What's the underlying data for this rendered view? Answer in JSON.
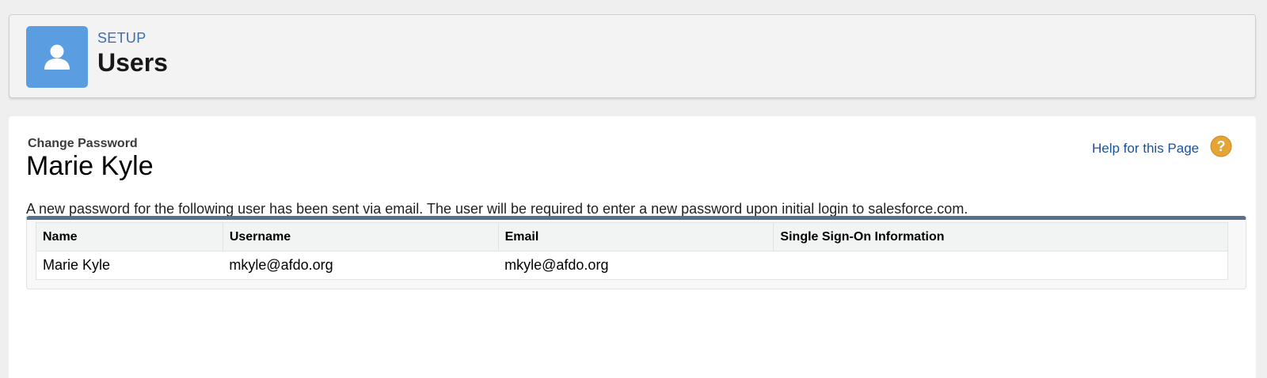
{
  "header": {
    "eyebrow": "SETUP",
    "title": "Users",
    "icon": "user-icon",
    "icon_color": "#5b9de1"
  },
  "main": {
    "subtitle": "Change Password",
    "name": "Marie Kyle",
    "help_label": "Help for this Page",
    "help_icon": "help-icon",
    "help_icon_color": "#e5a434",
    "message": "A new password for the following user has been sent via email. The user will be required to enter a new password upon initial login to salesforce.com."
  },
  "table": {
    "columns": [
      "Name",
      "Username",
      "Email",
      "Single Sign-On Information"
    ],
    "rows": [
      {
        "name": "Marie Kyle",
        "username": "mkyle@afdo.org",
        "email": "mkyle@afdo.org",
        "sso": ""
      }
    ],
    "header_border_color": "#56708e"
  }
}
